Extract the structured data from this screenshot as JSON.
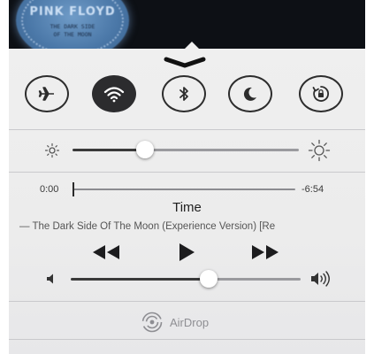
{
  "album": {
    "badge_title": "PINK FLOYD",
    "badge_line1": "THE DARK SIDE",
    "badge_line2": "OF THE MOON"
  },
  "toggles": [
    {
      "name": "airplane-mode-toggle",
      "icon": "airplane-icon",
      "on": false
    },
    {
      "name": "wifi-toggle",
      "icon": "wifi-icon",
      "on": true
    },
    {
      "name": "bluetooth-toggle",
      "icon": "bluetooth-icon",
      "on": false
    },
    {
      "name": "do-not-disturb-toggle",
      "icon": "moon-icon",
      "on": false
    },
    {
      "name": "rotation-lock-toggle",
      "icon": "rotation-lock-icon",
      "on": false
    }
  ],
  "brightness": {
    "level": 0.32
  },
  "playback": {
    "elapsed": "0:00",
    "remaining": "-6:54",
    "progress": 0.0,
    "title": "Time",
    "subtitle": "— The Dark Side Of The Moon (Experience Version) [Re"
  },
  "volume": {
    "level": 0.6
  },
  "airdrop": {
    "label": "AirDrop"
  },
  "colors": {
    "accent_dark": "#2c2c2e",
    "track_filled": "#3a3a3a",
    "track_empty": "#9a9a9e"
  }
}
